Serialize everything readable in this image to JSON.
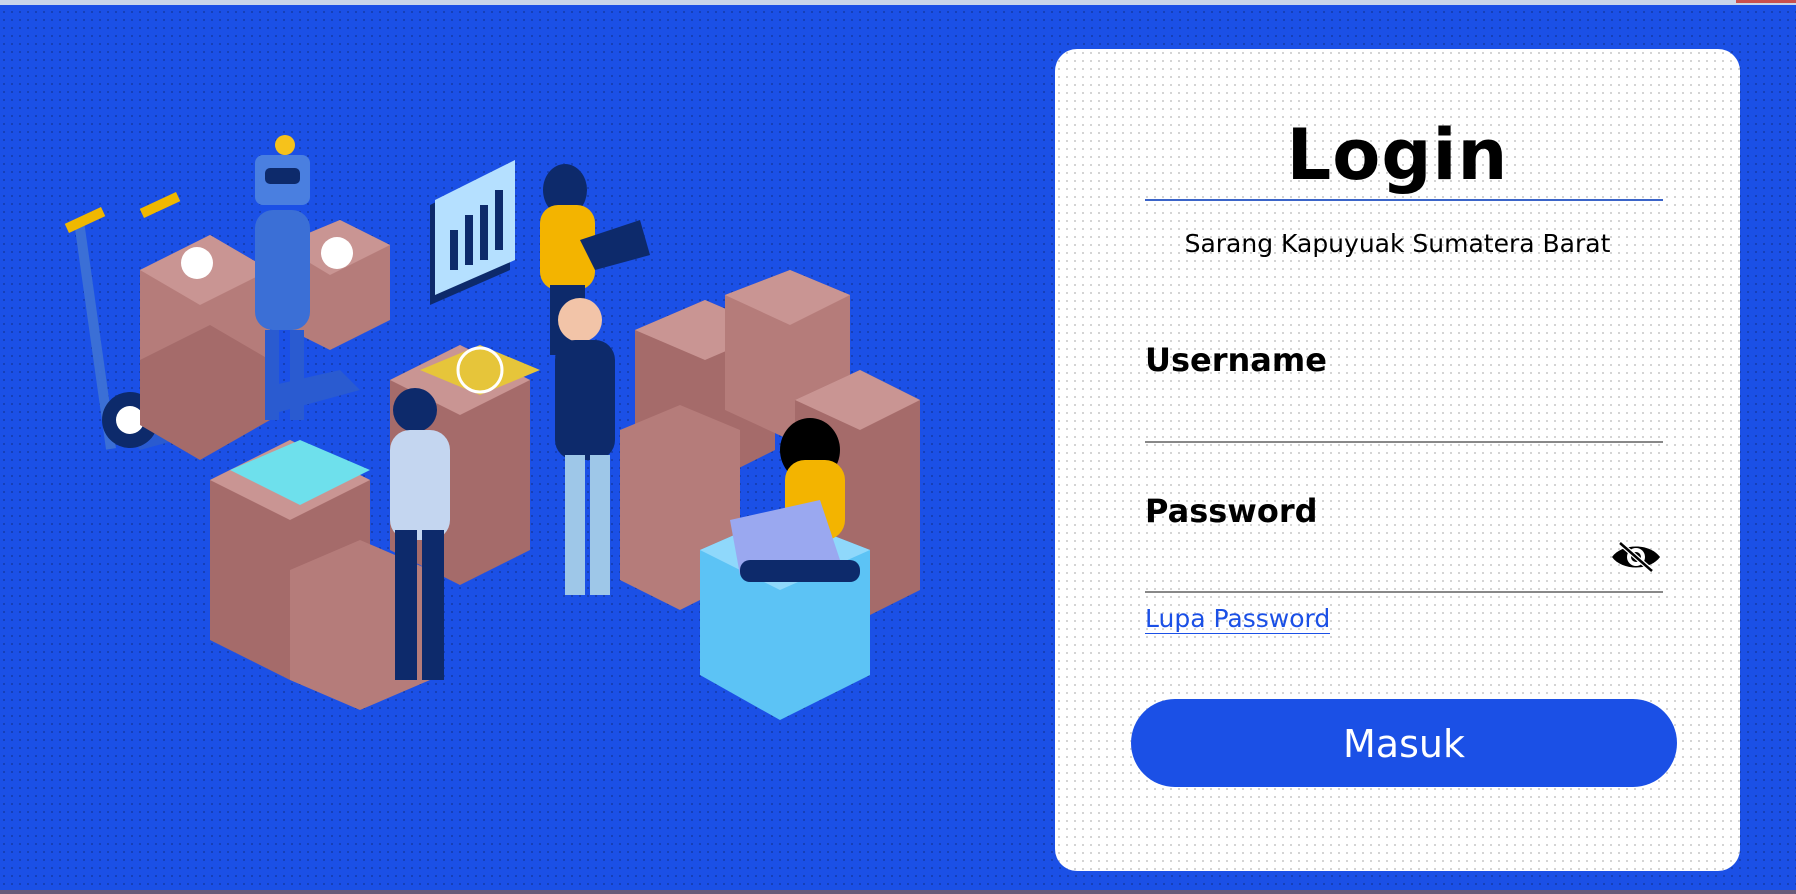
{
  "login": {
    "title": "Login",
    "subtitle": "Sarang Kapuyuak Sumatera Barat",
    "username_label": "Username",
    "username_value": "",
    "password_label": "Password",
    "password_value": "",
    "forgot_label": "Lupa Password",
    "submit_label": "Masuk",
    "show_password_icon": "eye-off-icon"
  },
  "colors": {
    "background": "#1b50e6",
    "card": "#ffffff",
    "accent": "#1b50e6"
  }
}
